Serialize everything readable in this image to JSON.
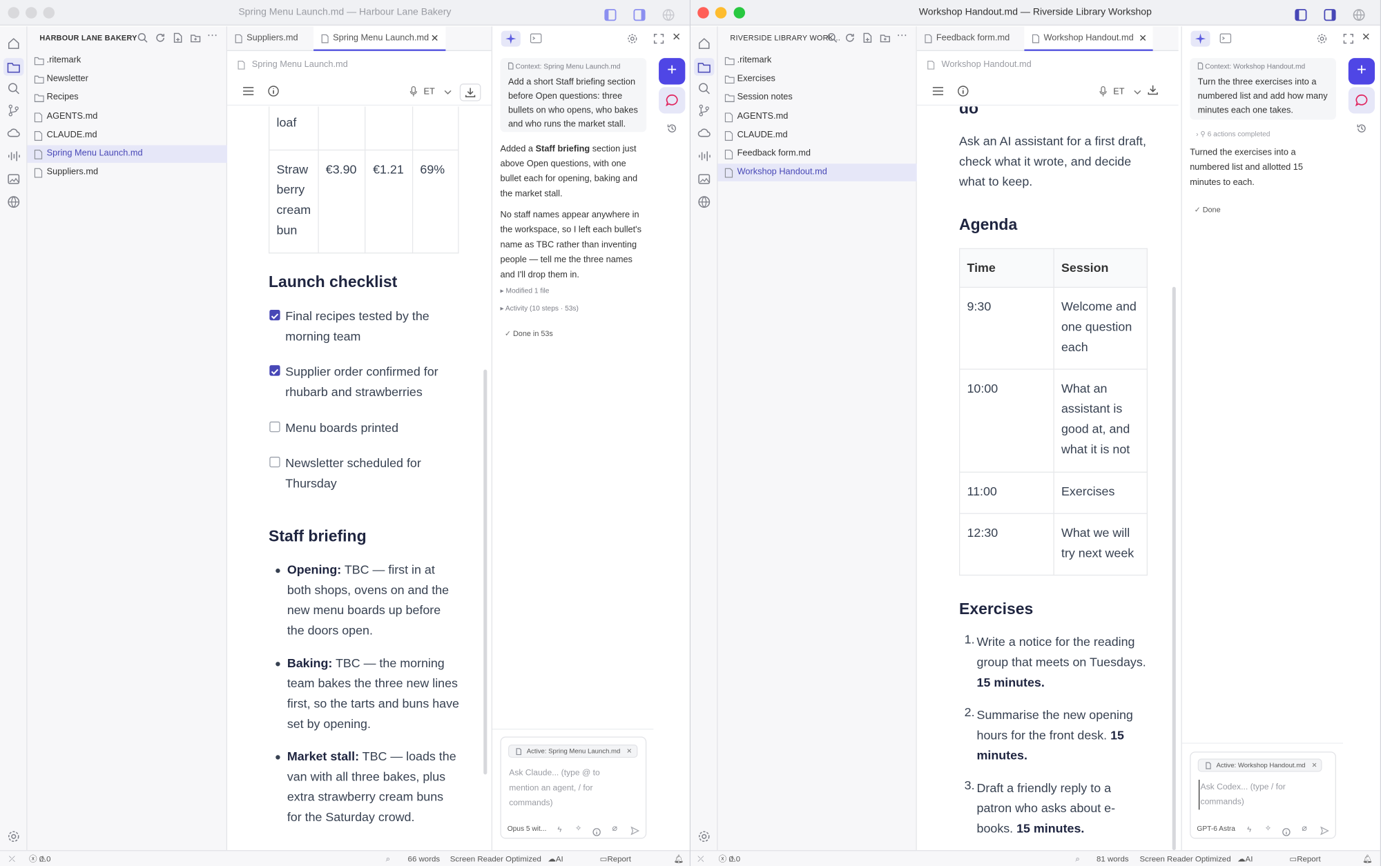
{
  "left": {
    "window_title": "Spring Menu Launch.md — Harbour Lane Bakery",
    "sidebar": {
      "title": "HARBOUR LANE BAKERY",
      "items": [
        {
          "label": ".ritemark",
          "type": "folder"
        },
        {
          "label": "Newsletter",
          "type": "folder"
        },
        {
          "label": "Recipes",
          "type": "folder"
        },
        {
          "label": "AGENTS.md",
          "type": "file"
        },
        {
          "label": "CLAUDE.md",
          "type": "file"
        },
        {
          "label": "Spring Menu Launch.md",
          "type": "file",
          "active": true
        },
        {
          "label": "Suppliers.md",
          "type": "file"
        }
      ]
    },
    "tabs": [
      {
        "label": "Suppliers.md"
      },
      {
        "label": "Spring Menu Launch.md",
        "active": true
      }
    ],
    "breadcrumb": "Spring Menu Launch.md",
    "toolbar": {
      "lang": "ET"
    },
    "doc": {
      "row_loaf": "loaf",
      "row_straw": {
        "name": "Straw berry cream bun",
        "price": "€3.90",
        "cost": "€1.21",
        "margin": "69%"
      },
      "checklist_title": "Launch checklist",
      "checklist": [
        {
          "text": "Final recipes tested by the morning team",
          "checked": true
        },
        {
          "text": "Supplier order confirmed for rhubarb and strawberries",
          "checked": true
        },
        {
          "text": "Menu boards printed",
          "checked": false
        },
        {
          "text": "Newsletter scheduled for Thursday",
          "checked": false
        }
      ],
      "briefing_title": "Staff briefing",
      "briefing": [
        {
          "label": "Opening:",
          "text": " TBC — first in at both shops, ovens on and the new menu boards up before the doors open."
        },
        {
          "label": "Baking:",
          "text": " TBC — the morning team bakes the three new lines first, so the tarts and buns have set by opening."
        },
        {
          "label": "Market stall:",
          "text": " TBC — loads the van with all three bakes, plus extra strawberry cream buns for the Saturday crowd."
        }
      ]
    },
    "ai": {
      "context": "Context: Spring Menu Launch.md",
      "user_msg": "Add a short Staff briefing section before Open questions: three bullets on who opens, who bakes and who runs the market stall.",
      "reply1_a": "Added a ",
      "reply1_b": "Staff briefing",
      "reply1_c": " section just above Open questions, with one bullet each for opening, baking and the market stall.",
      "reply2": "No staff names appear anywhere in the workspace, so I left each bullet's name as TBC rather than inventing people — tell me the three names and I'll drop them in.",
      "modified": "Modified 1 file",
      "activity": "Activity (10 steps · 53s)",
      "done": "Done in 53s",
      "chip": "Active: Spring Menu Launch.md",
      "placeholder": "Ask Claude... (type @ to mention an agent, / for commands)",
      "model": "Opus 5 wit..."
    },
    "status": {
      "errors": "0",
      "warnings": "0",
      "words": "66 words",
      "sr": "Screen Reader Optimized",
      "ai": "AI Ready",
      "report": "Report AI issue"
    }
  },
  "right": {
    "window_title": "Workshop Handout.md — Riverside Library Workshop",
    "sidebar": {
      "title": "RIVERSIDE LIBRARY WORK...",
      "items": [
        {
          "label": ".ritemark",
          "type": "folder"
        },
        {
          "label": "Exercises",
          "type": "folder"
        },
        {
          "label": "Session notes",
          "type": "folder"
        },
        {
          "label": "AGENTS.md",
          "type": "file"
        },
        {
          "label": "CLAUDE.md",
          "type": "file"
        },
        {
          "label": "Feedback form.md",
          "type": "file"
        },
        {
          "label": "Workshop Handout.md",
          "type": "file",
          "active": true
        }
      ]
    },
    "tabs": [
      {
        "label": "Feedback form.md"
      },
      {
        "label": "Workshop Handout.md",
        "active": true
      }
    ],
    "breadcrumb": "Workshop Handout.md",
    "toolbar": {
      "lang": "ET"
    },
    "doc": {
      "top_heading": "do",
      "intro": "Ask an AI assistant for a first draft, check what it wrote, and decide what to keep.",
      "agenda_title": "Agenda",
      "agenda_headers": [
        "Time",
        "Session"
      ],
      "agenda": [
        {
          "time": "9:30",
          "session": "Welcome and one question each"
        },
        {
          "time": "10:00",
          "session": "What an assistant is good at, and what it is not"
        },
        {
          "time": "11:00",
          "session": "Exercises"
        },
        {
          "time": "12:30",
          "session": "What we will try next week"
        }
      ],
      "exercises_title": "Exercises",
      "exercises": [
        {
          "num": "1.",
          "text": "Write a notice for the reading group that meets on Tuesdays. ",
          "bold": "15 minutes."
        },
        {
          "num": "2.",
          "text": "Summarise the new opening hours for the front desk. ",
          "bold": "15 minutes."
        },
        {
          "num": "3.",
          "text": "Draft a friendly reply to a patron who asks about e-books. ",
          "bold": "15 minutes."
        }
      ]
    },
    "ai": {
      "context": "Context: Workshop Handout.md",
      "user_msg": "Turn the three exercises into a numbered list and add how many minutes each one takes.",
      "actions": "6 actions completed",
      "reply": "Turned the exercises into a numbered list and allotted 15 minutes to each.",
      "done": "Done",
      "chip": "Active: Workshop Handout.md",
      "placeholder": "Ask Codex... (type / for commands)",
      "model": "GPT-6 Astra"
    },
    "status": {
      "errors": "0",
      "warnings": "0",
      "words": "81 words",
      "sr": "Screen Reader Optimized",
      "ai": "AI Ready",
      "report": "Report AI issue"
    }
  },
  "colors": {
    "accent": "#4747b6",
    "accent_fab": "#4f46e5",
    "close": "#ff5f57",
    "minimize": "#febc2e",
    "zoom": "#28c840",
    "inactive_light": "#d9d9dc"
  }
}
